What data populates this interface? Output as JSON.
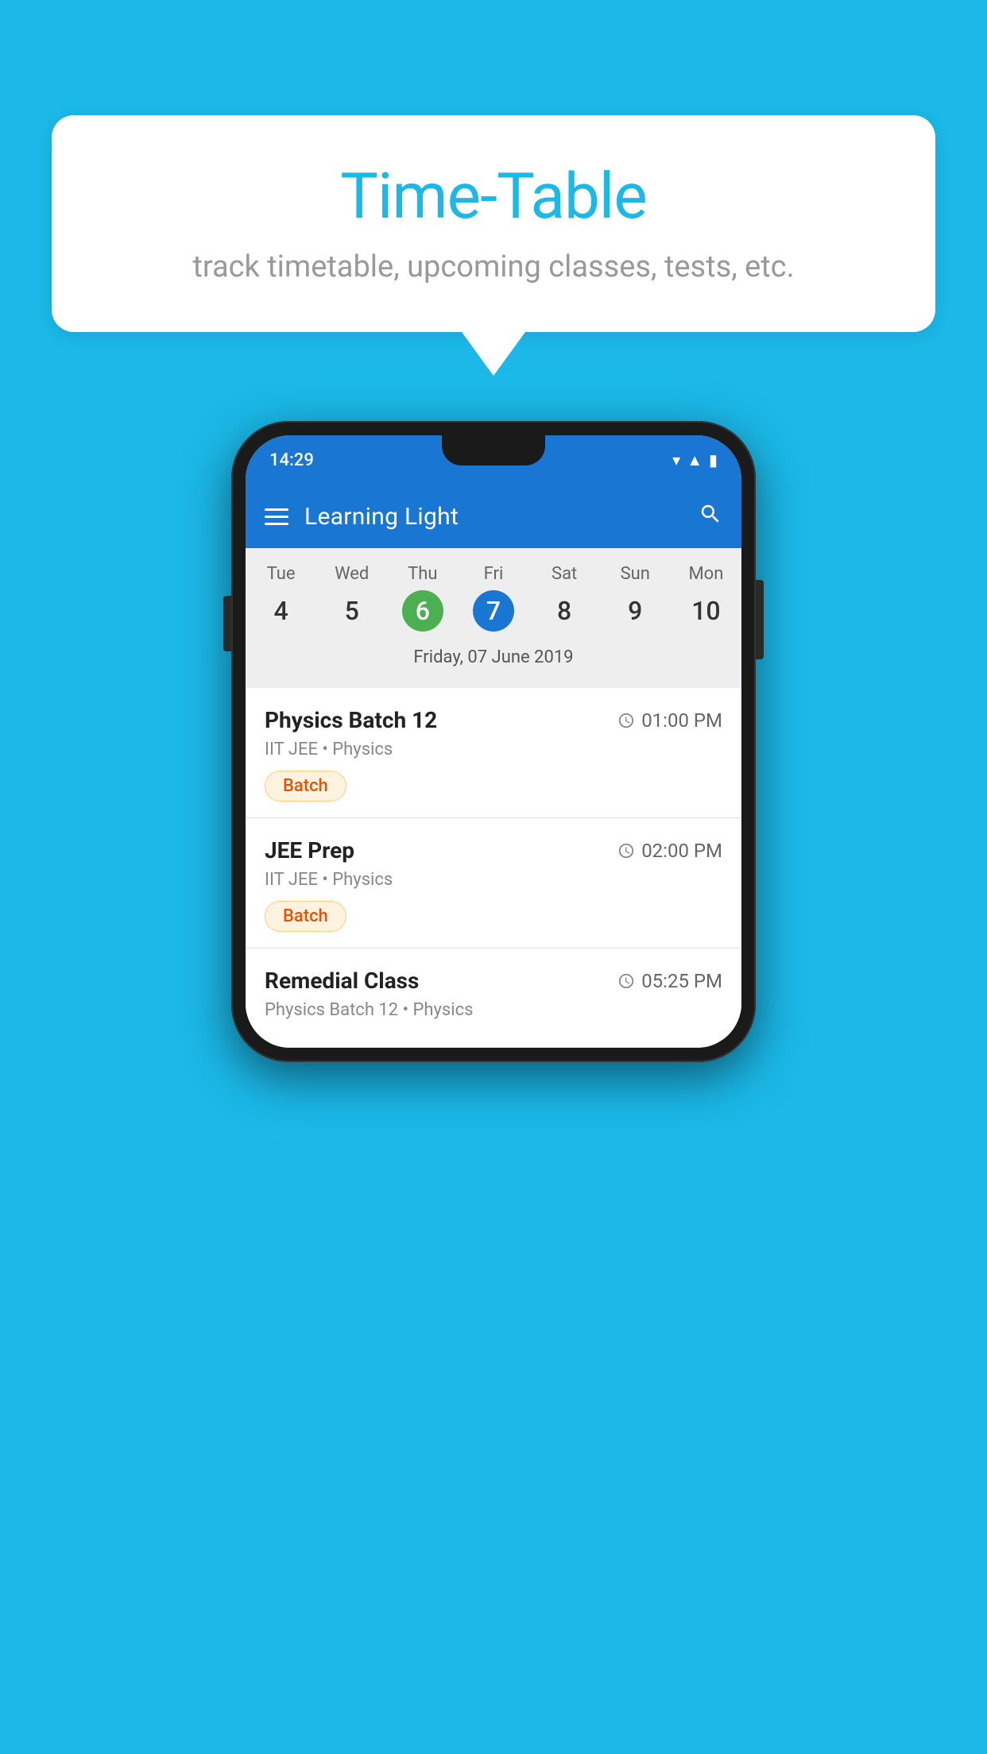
{
  "background_color": "#1bb8e8",
  "speech_bubble": {
    "title": "Time-Table",
    "subtitle": "track timetable, upcoming classes, tests, etc."
  },
  "phone": {
    "status_bar": {
      "time": "14:29"
    },
    "app_bar": {
      "title": "Learning Light",
      "menu_label": "Menu",
      "search_label": "Search"
    },
    "calendar": {
      "days": [
        {
          "name": "Tue",
          "number": "4",
          "state": "normal"
        },
        {
          "name": "Wed",
          "number": "5",
          "state": "normal"
        },
        {
          "name": "Thu",
          "number": "6",
          "state": "today"
        },
        {
          "name": "Fri",
          "number": "7",
          "state": "selected"
        },
        {
          "name": "Sat",
          "number": "8",
          "state": "normal"
        },
        {
          "name": "Sun",
          "number": "9",
          "state": "normal"
        },
        {
          "name": "Mon",
          "number": "10",
          "state": "normal"
        }
      ],
      "selected_date_label": "Friday, 07 June 2019"
    },
    "schedule": [
      {
        "title": "Physics Batch 12",
        "time": "01:00 PM",
        "subtitle": "IIT JEE • Physics",
        "badge": "Batch"
      },
      {
        "title": "JEE Prep",
        "time": "02:00 PM",
        "subtitle": "IIT JEE • Physics",
        "badge": "Batch"
      },
      {
        "title": "Remedial Class",
        "time": "05:25 PM",
        "subtitle": "Physics Batch 12 • Physics",
        "badge": null
      }
    ]
  }
}
